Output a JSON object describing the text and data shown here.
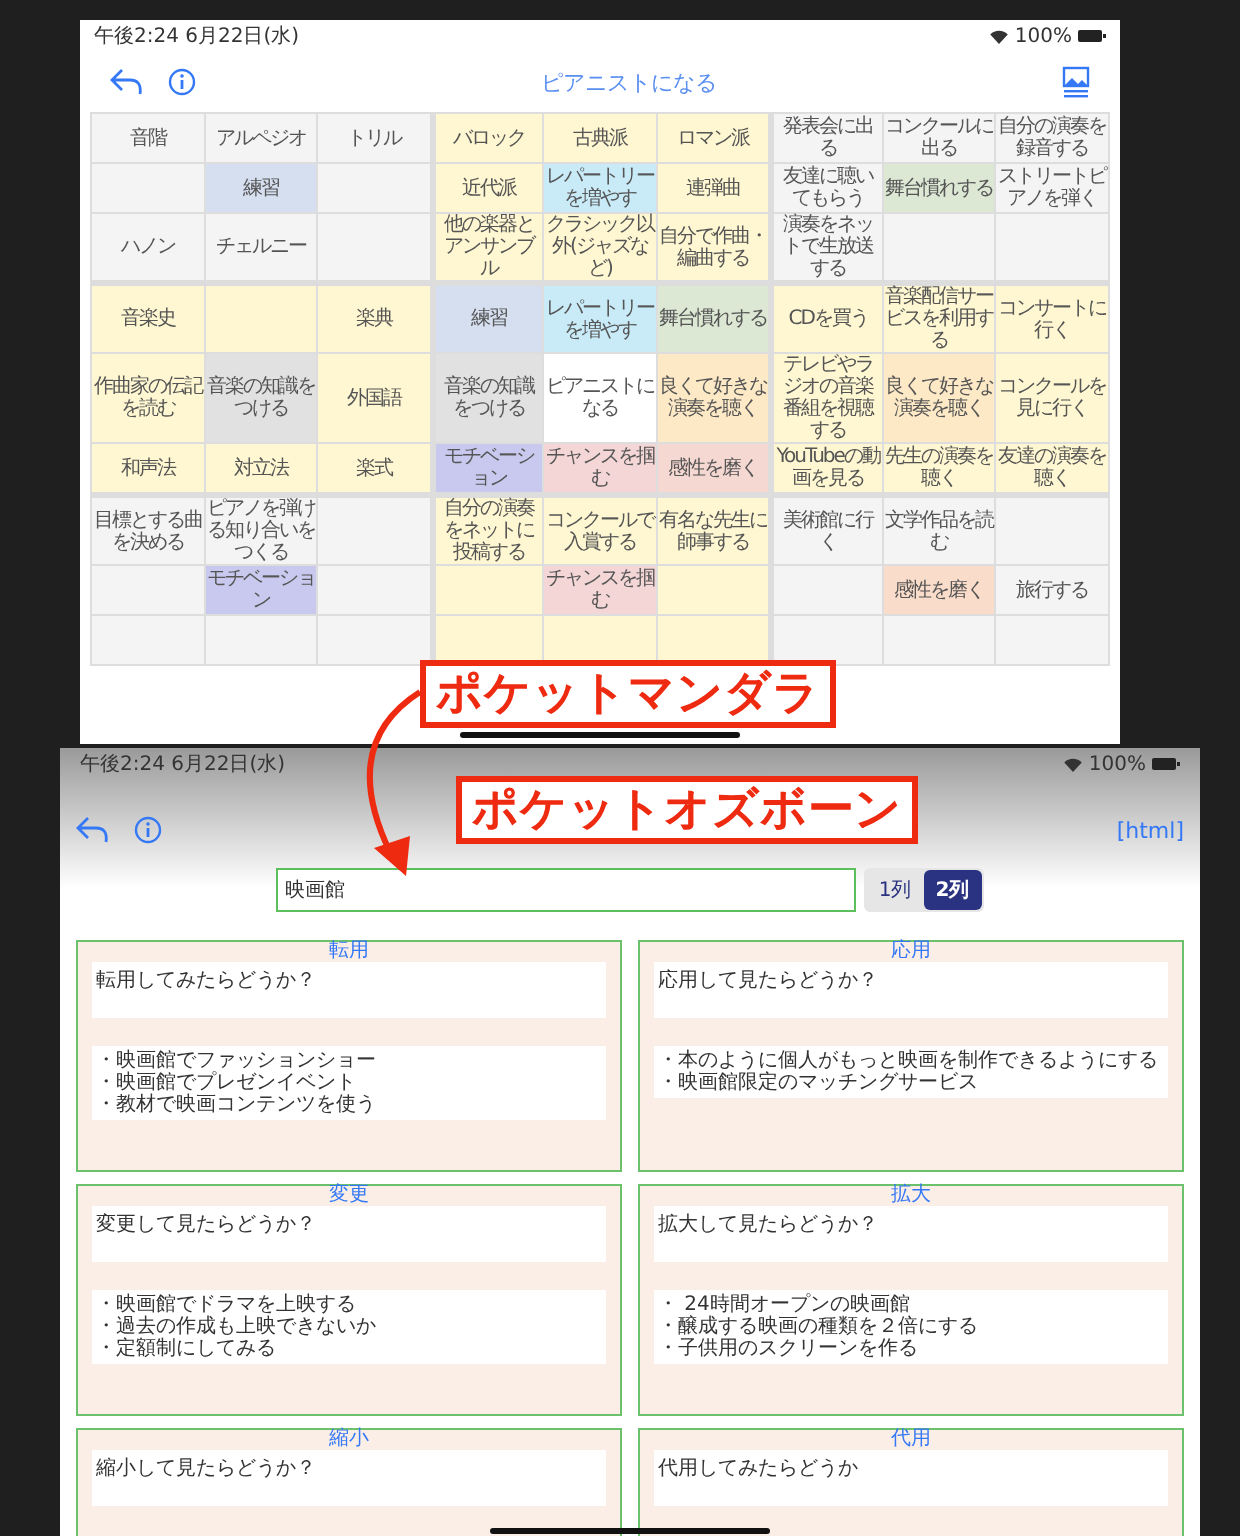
{
  "top_screen": {
    "status_bar": {
      "time": "午後2:24  6月22日(水)",
      "battery": "100%"
    },
    "title": "ピアニストになる",
    "grid": {
      "rows": [
        [
          {
            "text": "音階",
            "color": "#f4f4f4"
          },
          {
            "text": "アルペジオ",
            "color": "#f4f4f4"
          },
          {
            "text": "トリル",
            "color": "#f4f4f4"
          },
          {
            "text": "バロック",
            "color": "#fff7d1"
          },
          {
            "text": "古典派",
            "color": "#fff7d1"
          },
          {
            "text": "ロマン派",
            "color": "#fff7d1"
          },
          {
            "text": "発表会に出る",
            "color": "#f4f4f4"
          },
          {
            "text": "コンクールに出る",
            "color": "#f4f4f4"
          },
          {
            "text": "自分の演奏を録音する",
            "color": "#f4f4f4"
          }
        ],
        [
          {
            "color": "#f4f4f4"
          },
          {
            "text": "練習",
            "color": "#d6dff0"
          },
          {
            "color": "#f4f4f4"
          },
          {
            "text": "近代派",
            "color": "#fff7d1"
          },
          {
            "text": "レパートリーを増やす",
            "color": "#c9ebf7"
          },
          {
            "text": "連弾曲",
            "color": "#fff7d1"
          },
          {
            "text": "友達に聴いてもらう",
            "color": "#f4f4f4"
          },
          {
            "text": "舞台慣れする",
            "color": "#dce8d4"
          },
          {
            "text": "ストリートピアノを弾く",
            "color": "#f4f4f4"
          }
        ],
        [
          {
            "text": "ハノン",
            "color": "#f4f4f4"
          },
          {
            "text": "チェルニー",
            "color": "#f4f4f4"
          },
          {
            "color": "#f4f4f4"
          },
          {
            "text": "他の楽器とアンサンブル",
            "color": "#fff7d1"
          },
          {
            "text": "クラシック以外(ジャズなど)",
            "color": "#fff7d1"
          },
          {
            "text": "自分で作曲・編曲する",
            "color": "#fff7d1"
          },
          {
            "text": "演奏をネットで生放送する",
            "color": "#f4f4f4"
          },
          {
            "color": "#f4f4f4"
          },
          {
            "color": "#f4f4f4"
          }
        ],
        [
          {
            "text": "音楽史",
            "color": "#fff7d1"
          },
          {
            "color": "#fff7d1"
          },
          {
            "text": "楽典",
            "color": "#fff7d1"
          },
          {
            "text": "練習",
            "color": "#d6dff0"
          },
          {
            "text": "レパートリーを増やす",
            "color": "#c9ebf7"
          },
          {
            "text": "舞台慣れする",
            "color": "#dce8d4"
          },
          {
            "text": "CDを買う",
            "color": "#fff7d1"
          },
          {
            "text": "音楽配信サービスを利用する",
            "color": "#fff7d1"
          },
          {
            "text": "コンサートに行く",
            "color": "#fff7d1"
          }
        ],
        [
          {
            "text": "作曲家の伝記を読む",
            "color": "#fff7d1"
          },
          {
            "text": "音楽の知識をつける",
            "color": "#e1e1e1"
          },
          {
            "text": "外国語",
            "color": "#fff7d1"
          },
          {
            "text": "音楽の知識をつける",
            "color": "#e1e1e1"
          },
          {
            "text": "ピアニストになる",
            "color": "#ffffff"
          },
          {
            "text": "良くて好きな演奏を聴く",
            "color": "#fde9c6"
          },
          {
            "text": "テレビやラジオの音楽番組を視聴する",
            "color": "#fff7d1"
          },
          {
            "text": "良くて好きな演奏を聴く",
            "color": "#fde9c6"
          },
          {
            "text": "コンクールを見に行く",
            "color": "#fff7d1"
          }
        ],
        [
          {
            "text": "和声法",
            "color": "#fff7d1"
          },
          {
            "text": "対立法",
            "color": "#fff7d1"
          },
          {
            "text": "楽式",
            "color": "#fff7d1"
          },
          {
            "text": "モチベーション",
            "color": "#c9c9ef"
          },
          {
            "text": "チャンスを掴む",
            "color": "#f4d6d6"
          },
          {
            "text": "感性を磨く",
            "color": "#f6d8d2"
          },
          {
            "text": "YouTubeの動画を見る",
            "color": "#fff7d1"
          },
          {
            "text": "先生の演奏を聴く",
            "color": "#fff7d1"
          },
          {
            "text": "友達の演奏を聴く",
            "color": "#fff7d1"
          }
        ],
        [
          {
            "text": "目標とする曲を決める",
            "color": "#f4f4f4"
          },
          {
            "text": "ピアノを弾ける知り合いをつくる",
            "color": "#f4f4f4"
          },
          {
            "color": "#f4f4f4"
          },
          {
            "text": "自分の演奏をネットに投稿する",
            "color": "#fff7d1"
          },
          {
            "text": "コンクールで入賞する",
            "color": "#fff7d1"
          },
          {
            "text": "有名な先生に師事する",
            "color": "#fff7d1"
          },
          {
            "text": "美術館に行く",
            "color": "#f4f4f4"
          },
          {
            "text": "文学作品を読む",
            "color": "#f4f4f4"
          },
          {
            "color": "#f4f4f4"
          }
        ],
        [
          {
            "color": "#f4f4f4"
          },
          {
            "text": "モチベーション",
            "color": "#c9c9ef"
          },
          {
            "color": "#f4f4f4"
          },
          {
            "color": "#fff7d1"
          },
          {
            "text": "チャンスを掴む",
            "color": "#f4d6d6"
          },
          {
            "color": "#fff7d1"
          },
          {
            "color": "#f4f4f4"
          },
          {
            "text": "感性を磨く",
            "color": "#f9dcc9"
          },
          {
            "text": "旅行する",
            "color": "#f4f4f4"
          }
        ],
        [
          {
            "color": "#f4f4f4"
          },
          {
            "color": "#f4f4f4"
          },
          {
            "color": "#f4f4f4"
          },
          {
            "color": "#fff7d1"
          },
          {
            "color": "#fff7d1"
          },
          {
            "color": "#fff7d1"
          },
          {
            "color": "#f4f4f4"
          },
          {
            "color": "#f4f4f4"
          },
          {
            "color": "#f4f4f4"
          }
        ]
      ]
    }
  },
  "callouts": [
    "ポケットマンダラ",
    "ポケットオズボーン"
  ],
  "bottom_screen": {
    "status_bar": {
      "time": "午後2:24  6月22日(水)",
      "battery": "100%"
    },
    "html_link": "[html]",
    "search": {
      "value": "映画館"
    },
    "column_toggle": [
      {
        "label": "1列",
        "selected": false
      },
      {
        "label": "2列",
        "selected": true
      }
    ],
    "cards": [
      {
        "label": "転用",
        "question": "転用してみたらどうか？",
        "ideas": [
          "・映画館でファッションショー",
          "・映画館でプレゼンイベント",
          "・教材で映画コンテンツを使う"
        ]
      },
      {
        "label": "応用",
        "question": "応用して見たらどうか？",
        "ideas": [
          "・本のように個人がもっと映画を制作できるようにする",
          "・映画館限定のマッチングサービス"
        ]
      },
      {
        "label": "変更",
        "question": "変更して見たらどうか？",
        "ideas": [
          "・映画館でドラマを上映する",
          "・過去の作成も上映できないか",
          "・定額制にしてみる"
        ]
      },
      {
        "label": "拡大",
        "question": "拡大して見たらどうか？",
        "ideas": [
          "・ 24時間オープンの映画館",
          "・醸成する映画の種類を２倍にする",
          "・子供用のスクリーンを作る"
        ]
      },
      {
        "label": "縮小",
        "question": "縮小して見たらどうか？"
      },
      {
        "label": "代用",
        "question": "代用してみたらどうか"
      }
    ]
  }
}
